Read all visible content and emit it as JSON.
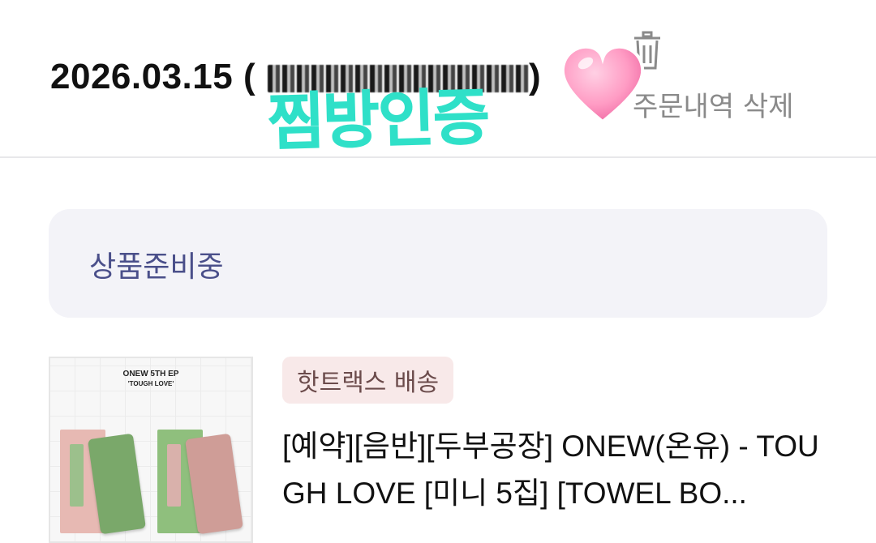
{
  "order": {
    "date": "2026.03.15 (",
    "close_paren": ")",
    "delete_label": "주문내역 삭제"
  },
  "sticker": {
    "text": "찜방인증"
  },
  "status": {
    "label": "상품준비중"
  },
  "product": {
    "badge": "핫트랙스 배송",
    "title": "[예약][음반][두부공장] ONEW(온유) - TOUGH LOVE [미니 5집] [TOWEL BO...",
    "thumbnail": {
      "title": "ONEW 5TH EP",
      "subtitle": "'TOUGH LOVE'"
    }
  },
  "colors": {
    "status_text": "#4a4f8a",
    "sticker": "#2fe0c8",
    "badge_bg": "#f8e9e9"
  },
  "icons": [
    "trash-icon",
    "heart-sticker-icon"
  ]
}
